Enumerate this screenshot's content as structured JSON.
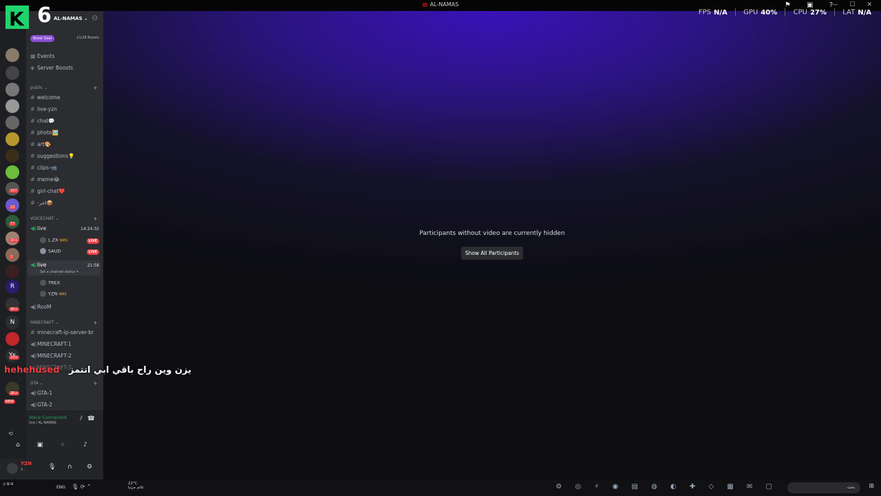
{
  "window": {
    "title": "AL-NAMAS"
  },
  "overlay": {
    "logo_letter": "K",
    "logo_number": "6"
  },
  "perf": {
    "fps_label": "FPS",
    "fps_value": "N/A",
    "gpu_label": "GPU",
    "gpu_value": "40%",
    "cpu_label": "CPU",
    "cpu_value": "27%",
    "lat_label": "LAT",
    "lat_value": "N/A"
  },
  "server": {
    "name": "AL-NAMAS",
    "boost_goal": "Boost Goal",
    "boost_count": "11/28 Boosts"
  },
  "rail_badges": [
    "107",
    "23",
    "77",
    "1K+",
    "2",
    "3K+",
    "23+",
    "3K+",
    "NEW"
  ],
  "rail_letters": [
    "R",
    "N",
    "Ys"
  ],
  "top_items": [
    {
      "icon": "calendar-icon",
      "label": "Events"
    },
    {
      "icon": "boost-icon",
      "label": "Server Boosts"
    }
  ],
  "categories": {
    "public": "public",
    "voicechat": "VOICECHAT",
    "minecraft": "MINECRAFT",
    "gta": "GTA"
  },
  "public_channels": [
    "welcome",
    "live-yzn",
    "chat💬",
    "photo🖼️",
    "art🎨",
    "suggestions💡",
    "clips-📹",
    "meme😂",
    "girl-chat❤️",
    "-اخر📦"
  ],
  "voice": {
    "live1": {
      "name": "live",
      "time": "14:24:32",
      "users": [
        {
          "name": "L.ZX",
          "tag": "NMS",
          "live": "LIVE"
        },
        {
          "name": "SAUD",
          "live": "LIVE"
        }
      ]
    },
    "live2": {
      "name": "live",
      "time": "21:58",
      "status": "Set a channel status",
      "users": [
        {
          "name": "TREX"
        },
        {
          "name": "YZN",
          "tag": "NMS"
        }
      ]
    },
    "room": "RooM"
  },
  "minecraft_channels": [
    {
      "kind": "text",
      "label": "minecraft-ip-server-br"
    },
    {
      "kind": "voice",
      "label": "MINECRAFT-1"
    },
    {
      "kind": "voice",
      "label": "MINECRAFT-2"
    },
    {
      "kind": "voice",
      "label": "MINECRAFT-3"
    }
  ],
  "gta_channels": [
    "GTA-1",
    "GTA-2"
  ],
  "voice_panel": {
    "status": "Voice Connected",
    "sub": "live / AL-NAMAS"
  },
  "user_panel": {
    "name": "YZN",
    "sub": "Y..."
  },
  "stage": {
    "hidden_msg": "Participants without video are currently hidden",
    "show_button": "Show All Participants"
  },
  "overlay_text": {
    "red": "hehehused",
    "arabic": "يزن وين راح باقي ابي اتتمز"
  },
  "taskbar": {
    "lang": "ENG",
    "temp": "22°C",
    "weather": "غائم جزئيا",
    "search": "بحث"
  }
}
